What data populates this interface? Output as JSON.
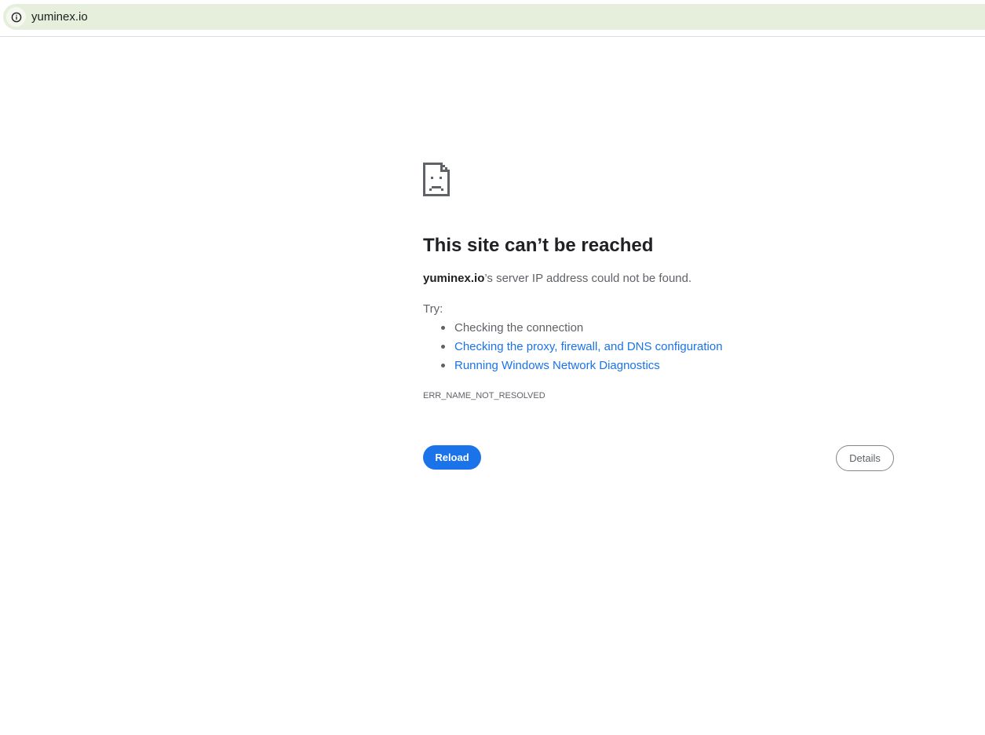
{
  "address_bar": {
    "url": "yuminex.io",
    "info_icon": "info-icon"
  },
  "error_page": {
    "icon": "sad-document-icon",
    "headline": "This site can’t be reached",
    "summary_host": "yuminex.io",
    "summary_rest": "’s server IP address could not be found.",
    "try_label": "Try:",
    "suggestions": [
      {
        "label": "Checking the connection",
        "link": false
      },
      {
        "label": "Checking the proxy, firewall, and DNS configuration",
        "link": true
      },
      {
        "label": "Running Windows Network Diagnostics",
        "link": true
      }
    ],
    "error_code": "ERR_NAME_NOT_RESOLVED",
    "reload_label": "Reload",
    "details_label": "Details"
  },
  "colors": {
    "accent": "#1a73e8",
    "omnibox_background": "#e6eedc",
    "text_primary": "#202124",
    "text_secondary": "#5f6368"
  }
}
